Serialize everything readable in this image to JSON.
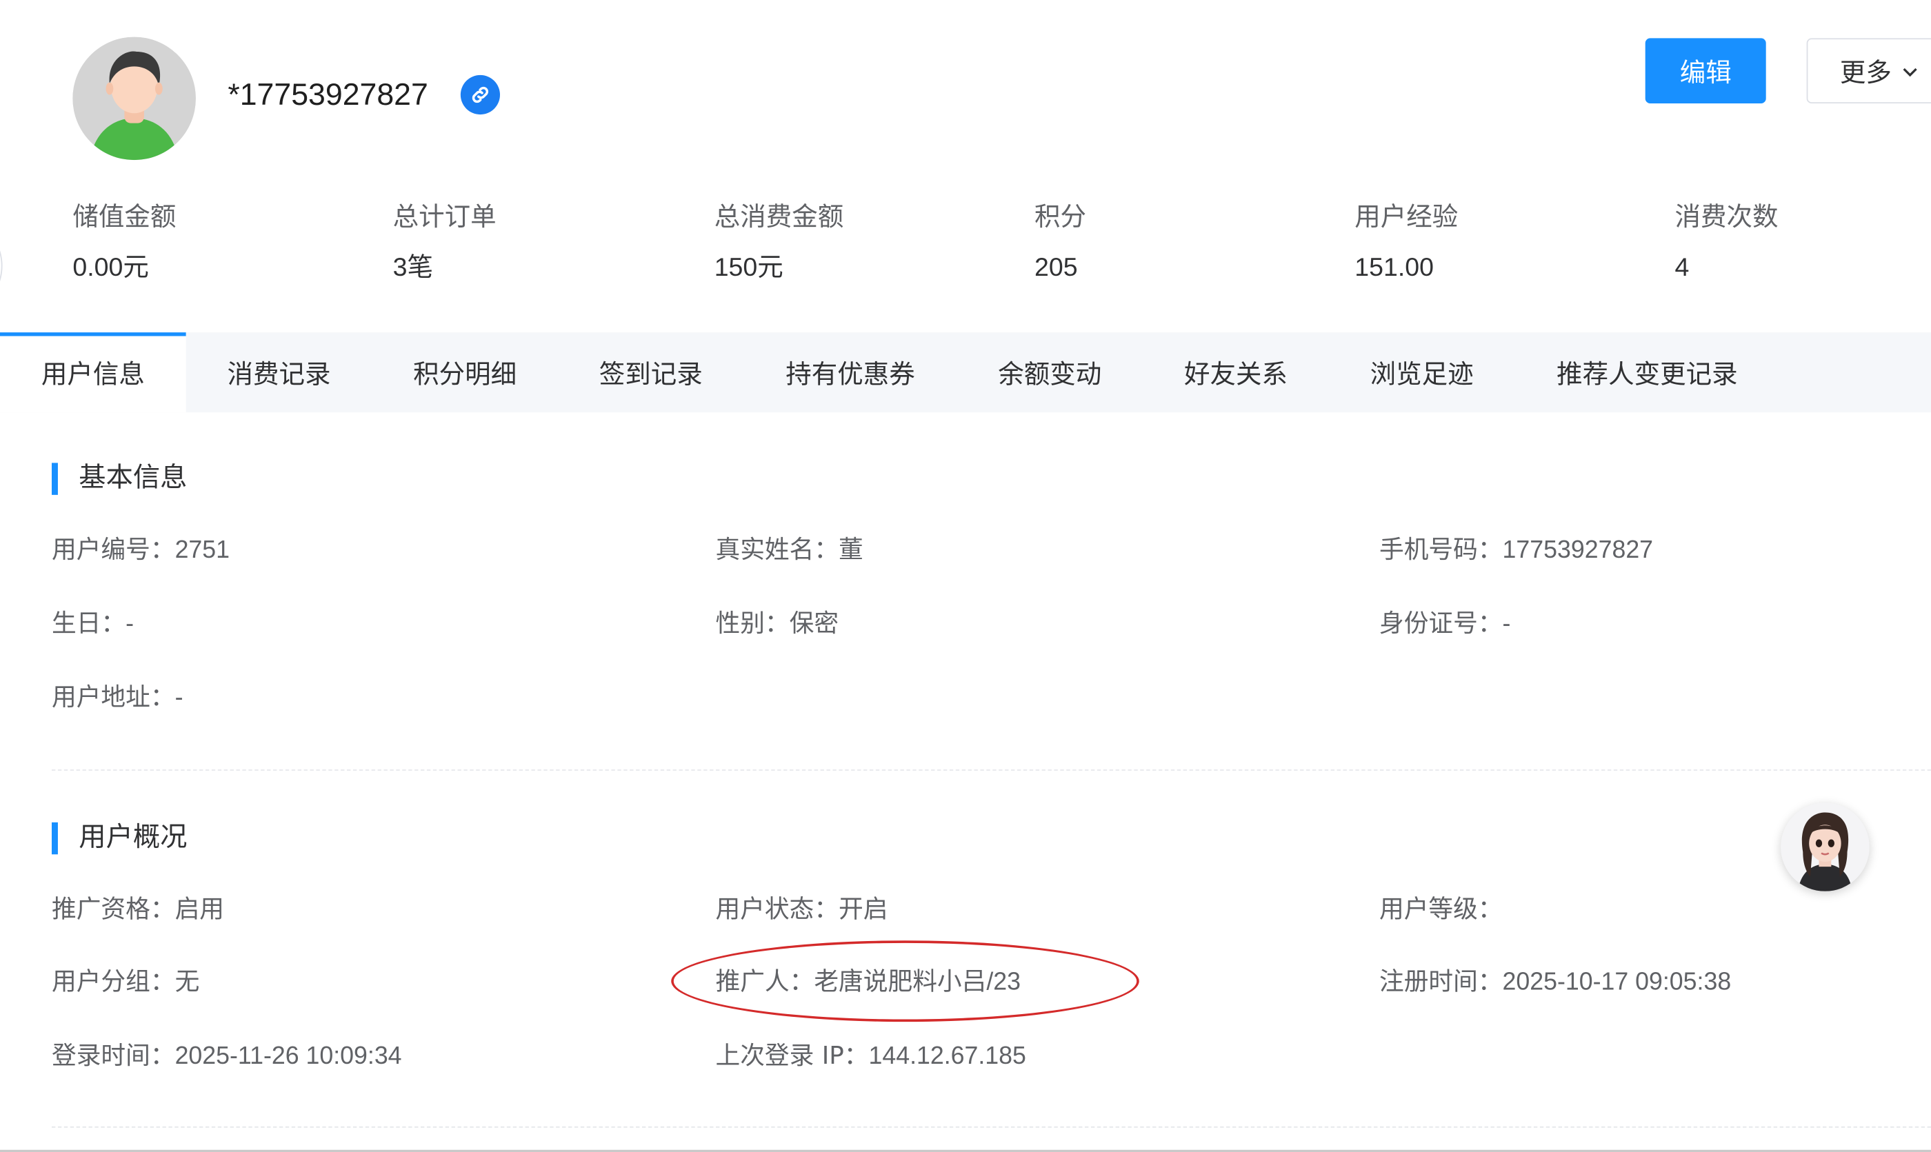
{
  "header": {
    "username": "*17753927827",
    "edit_label": "编辑",
    "more_label": "更多"
  },
  "stats": [
    {
      "label": "储值金额",
      "value": "0.00元"
    },
    {
      "label": "总计订单",
      "value": "3笔"
    },
    {
      "label": "总消费金额",
      "value": "150元"
    },
    {
      "label": "积分",
      "value": "205"
    },
    {
      "label": "用户经验",
      "value": "151.00"
    },
    {
      "label": "消费次数",
      "value": "4"
    }
  ],
  "tabs": [
    {
      "label": "用户信息",
      "active": true
    },
    {
      "label": "消费记录"
    },
    {
      "label": "积分明细"
    },
    {
      "label": "签到记录"
    },
    {
      "label": "持有优惠券"
    },
    {
      "label": "余额变动"
    },
    {
      "label": "好友关系"
    },
    {
      "label": "浏览足迹"
    },
    {
      "label": "推荐人变更记录"
    }
  ],
  "basic_info": {
    "title": "基本信息",
    "user_id": {
      "label": "用户编号：",
      "value": "2751"
    },
    "real_name": {
      "label": "真实姓名：",
      "value": "董"
    },
    "phone": {
      "label": "手机号码：",
      "value": "17753927827"
    },
    "birthday": {
      "label": "生日：",
      "value": "-"
    },
    "gender": {
      "label": "性别：",
      "value": "保密"
    },
    "id_card": {
      "label": "身份证号：",
      "value": "-"
    },
    "address": {
      "label": "用户地址：",
      "value": "-"
    }
  },
  "overview": {
    "title": "用户概况",
    "promo_qualification": {
      "label": "推广资格：",
      "value": "启用"
    },
    "user_status": {
      "label": "用户状态：",
      "value": "开启"
    },
    "user_level": {
      "label": "用户等级：",
      "value": ""
    },
    "user_group": {
      "label": "用户分组：",
      "value": "无"
    },
    "promoter": {
      "label": "推广人：",
      "value": "老唐说肥料小吕/23"
    },
    "register_time": {
      "label": "注册时间：",
      "value": "2025-10-17 09:05:38"
    },
    "login_time": {
      "label": "登录时间：",
      "value": "2025-11-26 10:09:34"
    },
    "last_login_ip": {
      "label": "上次登录 IP：",
      "value": "144.12.67.185"
    }
  },
  "colors": {
    "primary": "#1890ff",
    "highlight": "#d42a2a",
    "tab_bg": "#f5f7fa"
  },
  "icons": {
    "link_badge": "link-icon",
    "more_caret": "chevron-down-icon",
    "avatar": "user-avatar",
    "assistant": "assistant-avatar"
  }
}
